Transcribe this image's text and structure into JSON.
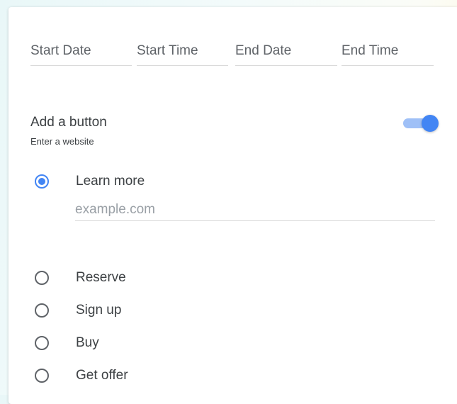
{
  "schedule": {
    "start_date_label": "Start Date",
    "start_time_label": "Start Time",
    "end_date_label": "End Date",
    "end_time_label": "End Time"
  },
  "button_section": {
    "title": "Add a button",
    "subtitle": "Enter a website",
    "toggle_on": true,
    "accent_color": "#4285f4",
    "options": [
      {
        "label": "Learn more",
        "selected": true
      },
      {
        "label": "Reserve",
        "selected": false
      },
      {
        "label": "Sign up",
        "selected": false
      },
      {
        "label": "Buy",
        "selected": false
      },
      {
        "label": "Get offer",
        "selected": false
      }
    ],
    "website_placeholder": "example.com"
  }
}
